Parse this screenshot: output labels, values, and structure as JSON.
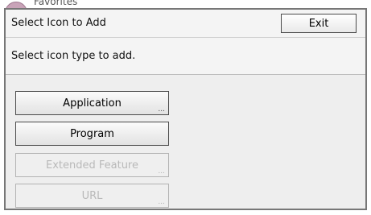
{
  "background": {
    "peek_text": "Favorites"
  },
  "dialog": {
    "title": "Select Icon to Add",
    "exit_label": "Exit",
    "instruction": "Select icon type to add."
  },
  "options": [
    {
      "label": "Application",
      "enabled": true,
      "more": "..."
    },
    {
      "label": "Program",
      "enabled": true,
      "more": ""
    },
    {
      "label": "Extended Feature",
      "enabled": false,
      "more": "..."
    },
    {
      "label": "URL",
      "enabled": false,
      "more": "..."
    }
  ],
  "colors": {
    "enabled_border": "#4a4a4a",
    "disabled_text": "#b9b9b9",
    "panel_bg": "#eeeeee"
  }
}
